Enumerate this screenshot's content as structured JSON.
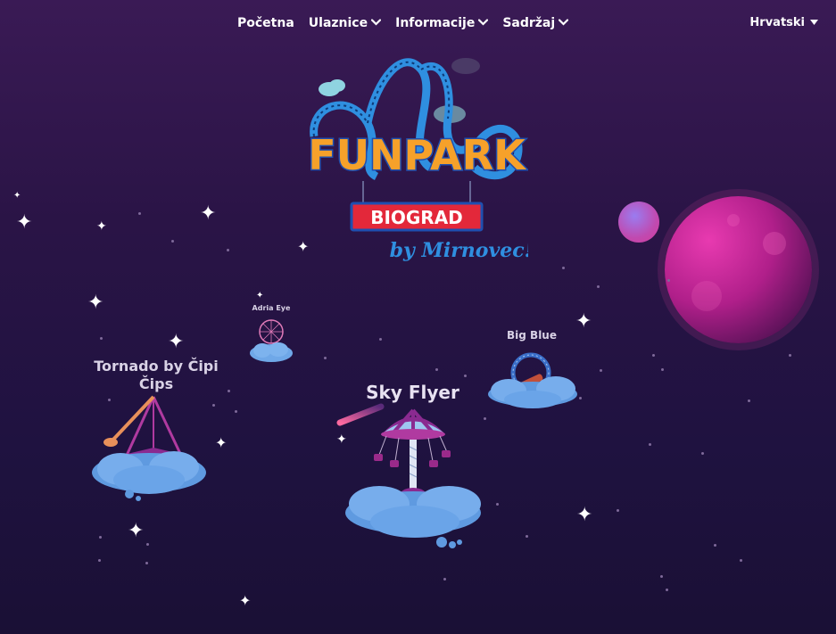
{
  "nav": {
    "items": [
      {
        "label": "Početna",
        "dropdown": false
      },
      {
        "label": "Ulaznice",
        "dropdown": true
      },
      {
        "label": "Informacije",
        "dropdown": true
      },
      {
        "label": "Sadržaj",
        "dropdown": true
      }
    ],
    "language": "Hrvatski"
  },
  "logo": {
    "title": "FUNPARK",
    "subtitle": "BIOGRAD",
    "tagline": "by Mirnovec!"
  },
  "rides": {
    "tornado": "Tornado by Čipi Čips",
    "adria_eye": "Adria Eye",
    "sky_flyer": "Sky Flyer",
    "big_blue": "Big Blue"
  },
  "colors": {
    "bg_top": "#3a1a55",
    "bg_bottom": "#1a1035",
    "logo_blue": "#2f8fe0",
    "logo_orange": "#f6a12a",
    "badge_red": "#e3283a",
    "planet_pink": "#d43a9c",
    "cloud_blue": "#6fa8e8"
  },
  "icons": {
    "chevron": "chevron-down-icon",
    "caret": "caret-down-icon",
    "sparkle": "sparkle-icon"
  }
}
